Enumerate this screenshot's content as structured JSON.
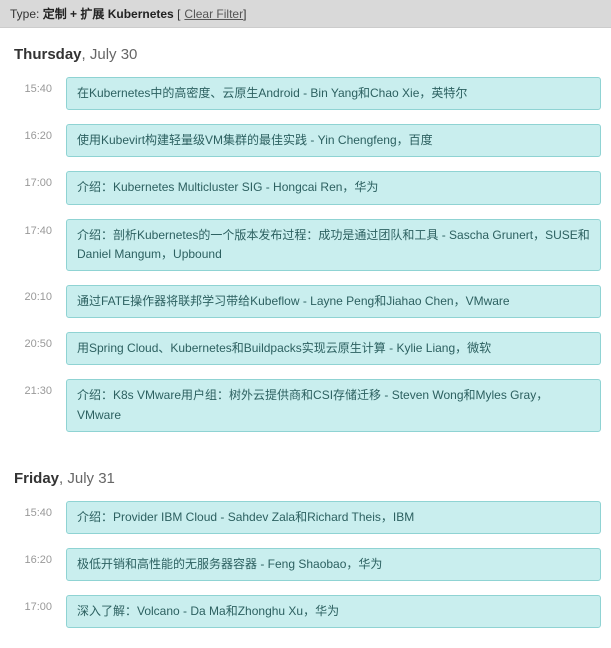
{
  "filter": {
    "label": "Type:",
    "type": "定制 + 扩展 Kubernetes",
    "clear_open": "[",
    "clear": "Clear Filter",
    "clear_close": "]"
  },
  "days": [
    {
      "dow": "Thursday",
      "rest": ", July 30",
      "sessions": [
        {
          "time": "15:40",
          "title": "在Kubernetes中的高密度、云原生Android - Bin Yang和Chao Xie，英特尔"
        },
        {
          "time": "16:20",
          "title": "使用Kubevirt构建轻量级VM集群的最佳实践 - Yin Chengfeng，百度"
        },
        {
          "time": "17:00",
          "title": "介绍：Kubernetes Multicluster SIG - Hongcai Ren，华为"
        },
        {
          "time": "17:40",
          "title": "介绍：剖析Kubernetes的一个版本发布过程：成功是通过团队和工具 - Sascha Grunert，SUSE和Daniel Mangum，Upbound"
        },
        {
          "time": "20:10",
          "title": "通过FATE操作器将联邦学习带给Kubeflow - Layne Peng和Jiahao Chen，VMware"
        },
        {
          "time": "20:50",
          "title": "用Spring Cloud、Kubernetes和Buildpacks实现云原生计算 - Kylie Liang，微软"
        },
        {
          "time": "21:30",
          "title": "介绍：K8s VMware用户组：树外云提供商和CSI存储迁移 - Steven Wong和Myles Gray，VMware"
        }
      ]
    },
    {
      "dow": "Friday",
      "rest": ", July 31",
      "sessions": [
        {
          "time": "15:40",
          "title": "介绍：Provider IBM Cloud - Sahdev Zala和Richard Theis，IBM"
        },
        {
          "time": "16:20",
          "title": "极低开销和高性能的无服务器容器 - Feng Shaobao，华为"
        },
        {
          "time": "17:00",
          "title": "深入了解：Volcano - Da Ma和Zhonghu Xu，华为"
        }
      ]
    }
  ]
}
